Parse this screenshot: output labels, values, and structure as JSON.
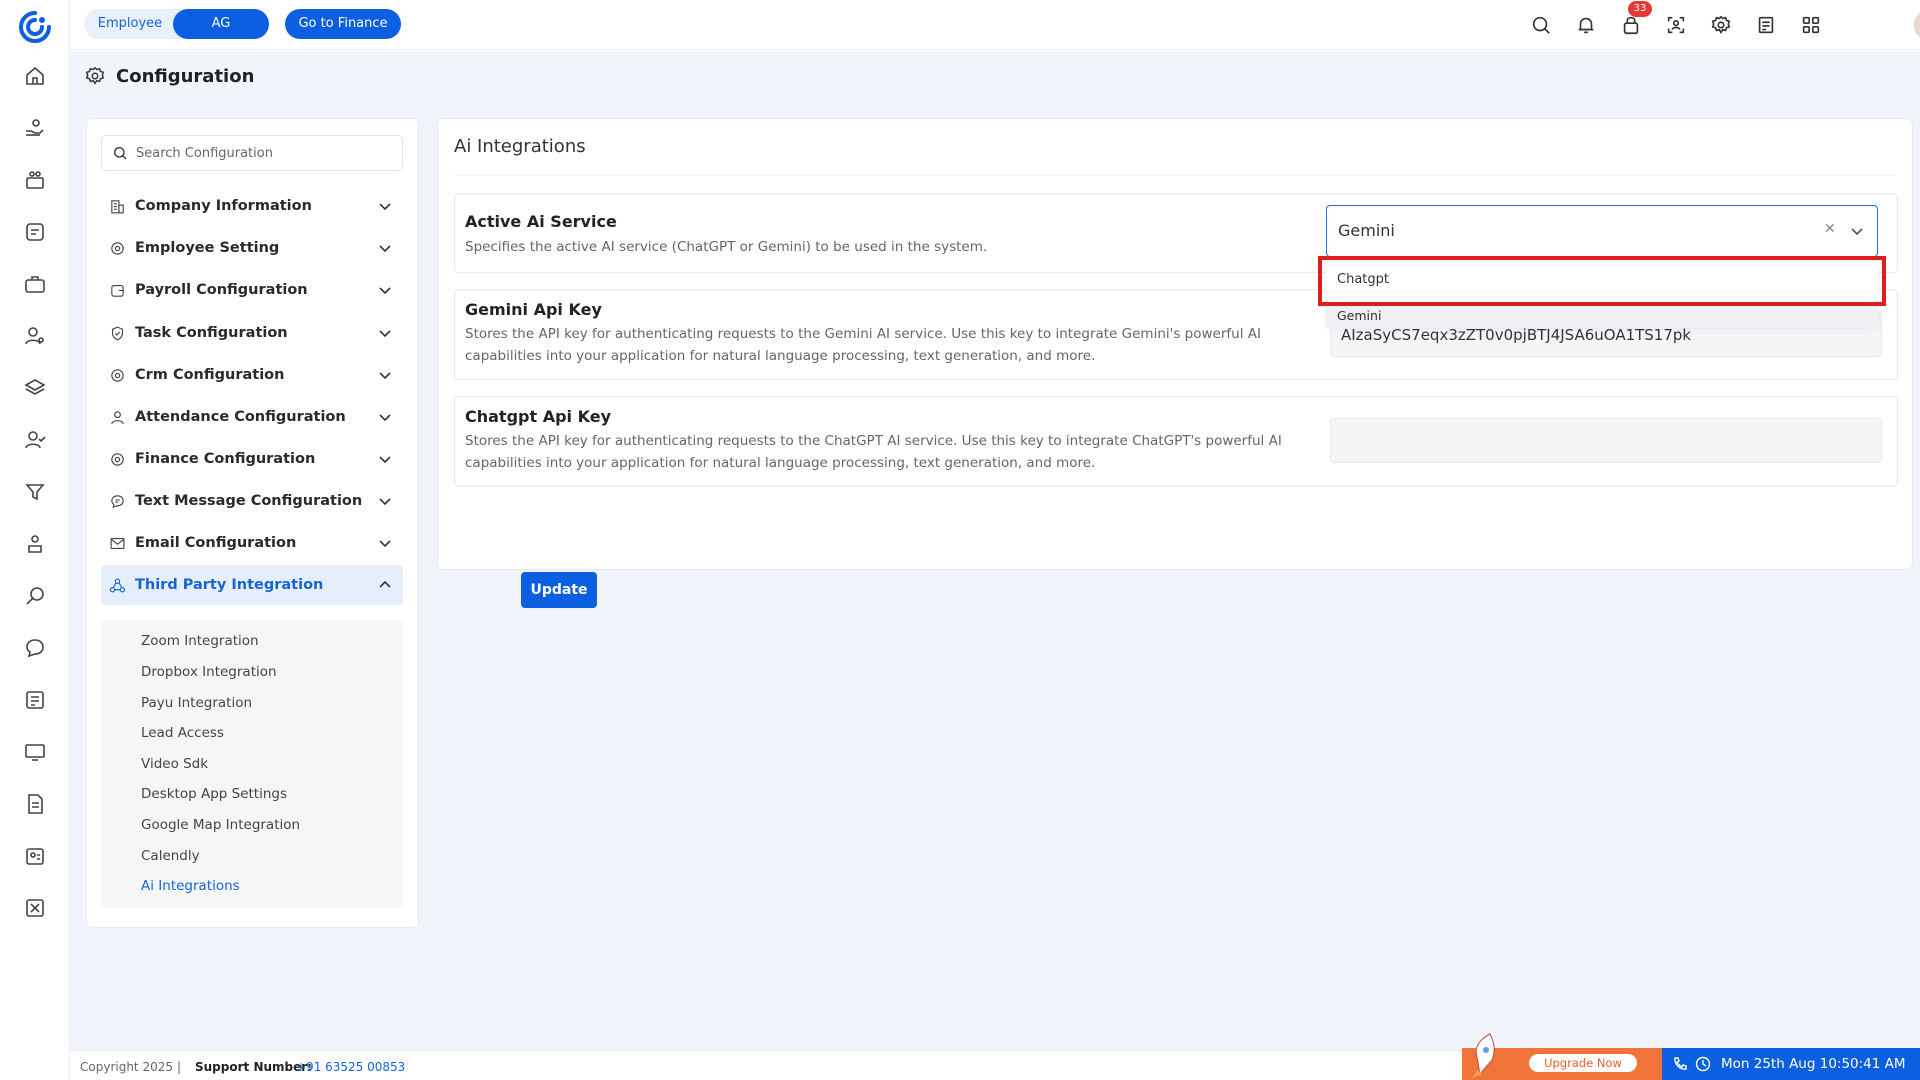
{
  "header": {
    "toggle": {
      "employee_label": "Employee",
      "ag_label": "AG"
    },
    "finance_button": "Go to Finance",
    "notification_count": "33"
  },
  "page": {
    "title": "Configuration"
  },
  "config_nav": {
    "search_placeholder": "Search Configuration",
    "items": [
      {
        "label": "Company Information",
        "icon": "building-icon"
      },
      {
        "label": "Employee Setting",
        "icon": "gear-icon"
      },
      {
        "label": "Payroll Configuration",
        "icon": "wallet-icon"
      },
      {
        "label": "Task Configuration",
        "icon": "shield-check-icon"
      },
      {
        "label": "Crm Configuration",
        "icon": "gear-icon"
      },
      {
        "label": "Attendance Configuration",
        "icon": "user-icon"
      },
      {
        "label": "Finance Configuration",
        "icon": "gear-icon"
      },
      {
        "label": "Text Message Configuration",
        "icon": "message-icon"
      },
      {
        "label": "Email Configuration",
        "icon": "mail-icon"
      },
      {
        "label": "Third Party Integration",
        "icon": "integration-icon"
      }
    ],
    "sub_items": [
      "Zoom Integration",
      "Dropbox Integration",
      "Payu Integration",
      "Lead Access",
      "Video Sdk",
      "Desktop App Settings",
      "Google Map Integration",
      "Calendly",
      "Ai Integrations"
    ]
  },
  "main": {
    "title": "Ai Integrations",
    "active_service": {
      "title": "Active Ai Service",
      "desc": "Specifies the active AI service (ChatGPT or Gemini) to be used in the system.",
      "selected": "Gemini",
      "options": [
        "Chatgpt",
        "Gemini"
      ]
    },
    "gemini": {
      "title": "Gemini Api Key",
      "desc": "Stores the API key for authenticating requests to the Gemini AI service. Use this key to integrate Gemini's powerful AI capabilities into your application for natural language processing, text generation, and more.",
      "value": "AIzaSyCS7eqx3zZT0v0pjBTJ4JSA6uOA1TS17pk"
    },
    "chatgpt": {
      "title": "Chatgpt Api Key",
      "desc": "Stores the API key for authenticating requests to the ChatGPT AI service. Use this key to integrate ChatGPT's powerful AI capabilities into your application for natural language processing, text generation, and more.",
      "value": ""
    },
    "update_button": "Update"
  },
  "footer": {
    "copyright": "Copyright 2025",
    "separator": "|",
    "support_label": "Support Number:",
    "support_number": "+91 63525 00853",
    "upgrade": "Upgrade Now",
    "datetime": "Mon 25th Aug 10:50:41 AM"
  },
  "colors": {
    "accent": "#0b5fe0",
    "highlight": "#e01d1d",
    "upgrade": "#f0743a"
  }
}
